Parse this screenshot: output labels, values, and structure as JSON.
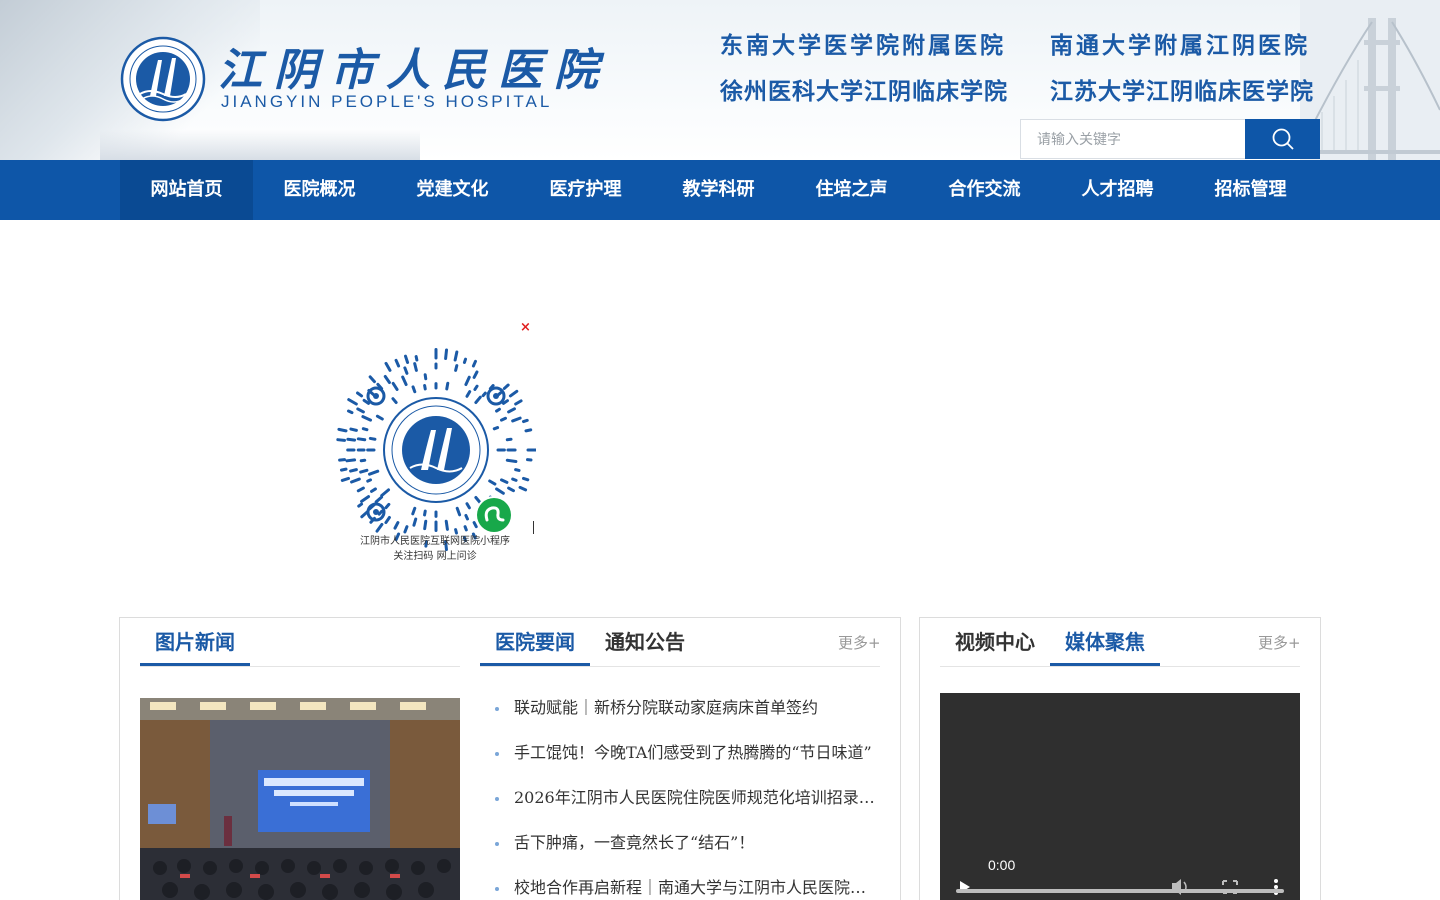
{
  "header": {
    "logo_cn": "江阴市人民医院",
    "logo_en": "JIANGYIN PEOPLE'S HOSPITAL",
    "affiliations": [
      "东南大学医学院附属医院",
      "南通大学附属江阴医院",
      "徐州医科大学江阴临床学院",
      "江苏大学江阴临床医学院"
    ],
    "search_placeholder": "请输入关键字",
    "search_icon": "search-icon"
  },
  "nav": {
    "items": [
      {
        "label": "网站首页",
        "active": true
      },
      {
        "label": "医院概况"
      },
      {
        "label": "党建文化"
      },
      {
        "label": "医疗护理"
      },
      {
        "label": "教学科研"
      },
      {
        "label": "住培之声"
      },
      {
        "label": "合作交流"
      },
      {
        "label": "人才招聘"
      },
      {
        "label": "招标管理"
      }
    ]
  },
  "qr_popup": {
    "close_label": "×",
    "caption_line1": "江阴市人民医院互联网医院小程序",
    "caption_line2": "关注扫码 网上问诊"
  },
  "news_panel": {
    "tab_photo": "图片新闻",
    "tab_news": "医院要闻",
    "tab_notice": "通知公告",
    "more": "更多+",
    "items": [
      "联动赋能｜新桥分院联动家庭病床首单签约",
      "手工馄饨！今晚TA们感受到了热腾腾的“节日味道”",
      "2026年江阴市人民医院住院医师规范化培训招录…",
      "舌下肿痛，一查竟然长了“结石”！",
      "校地合作再启新程｜南通大学与江阴市人民医院…"
    ]
  },
  "media_panel": {
    "tab_video": "视频中心",
    "tab_media": "媒体聚焦",
    "more": "更多+",
    "video_time": "0:00"
  },
  "colors": {
    "brand_blue": "#0e56a8",
    "text_blue": "#1b5aa6",
    "close_red": "#e02020"
  }
}
